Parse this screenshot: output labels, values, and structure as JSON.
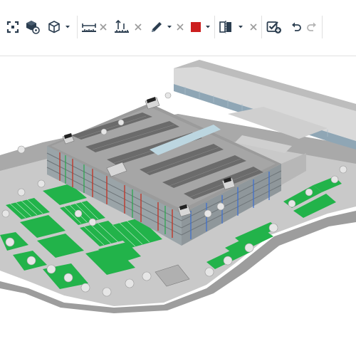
{
  "toolbar": {
    "buttons": [
      {
        "id": "fit",
        "icon": "expand-icon"
      },
      {
        "id": "model-browser",
        "icon": "cube-gear-icon"
      },
      {
        "id": "view-cube",
        "icon": "cube-outline-icon"
      },
      {
        "id": "measure-distance",
        "icon": "measure-horizontal-icon"
      },
      {
        "id": "measure-vertical",
        "icon": "measure-vertical-icon"
      },
      {
        "id": "markup-pen",
        "icon": "pen-icon"
      },
      {
        "id": "markup-color",
        "icon": "color-swatch-icon",
        "color": "#cc1f1f"
      },
      {
        "id": "section",
        "icon": "section-plane-icon"
      },
      {
        "id": "issue",
        "icon": "checkbox-add-icon"
      },
      {
        "id": "undo",
        "icon": "undo-icon"
      },
      {
        "id": "redo",
        "icon": "redo-icon"
      }
    ],
    "accent": "#2c3e50"
  },
  "viewport": {
    "subject": "3d-model-parking-structure",
    "colors": {
      "parking_green": "#22b34a",
      "deck_gray": "#8c8c8c",
      "road_gray": "#a3a3a3",
      "red_frame": "#c0392b"
    }
  }
}
